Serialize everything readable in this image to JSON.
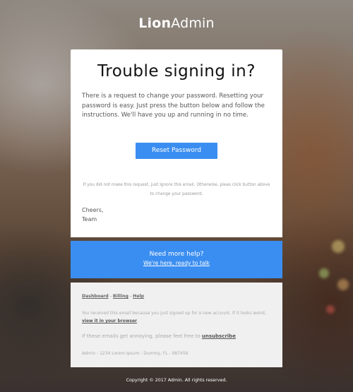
{
  "brand": {
    "part1": "Lion",
    "part2": "Admin"
  },
  "card": {
    "title": "Trouble signing in?",
    "intro": "There is a request to change your password. Resetting your password is easy. Just press the button below and follow the instructions. We'll have you up and running in no time.",
    "reset_button": "Reset Password",
    "note": "If you did not make this request, just ignore this email. Otherwise, pleas click button above to change your password.",
    "sign_line1": "Cheers,",
    "sign_line2": "Team"
  },
  "help": {
    "heading": "Need more help?",
    "link": "We're here, ready to talk"
  },
  "footer": {
    "links": [
      "Dashboard",
      "Billing",
      "Help"
    ],
    "separator": "-",
    "received": "You received this email because you just signed up for a new account. If it looks weird,",
    "view_link": "view it in your browser",
    "period": ".",
    "annoying": "If these emails get annoying, please feel free to",
    "unsubscribe": "unsubscribe",
    "address": "Admin - 1234 Lorem Ipsum - Dummy, FL - 987456"
  },
  "copyright": "Copyright © 2017 Admin. All rights reserved."
}
